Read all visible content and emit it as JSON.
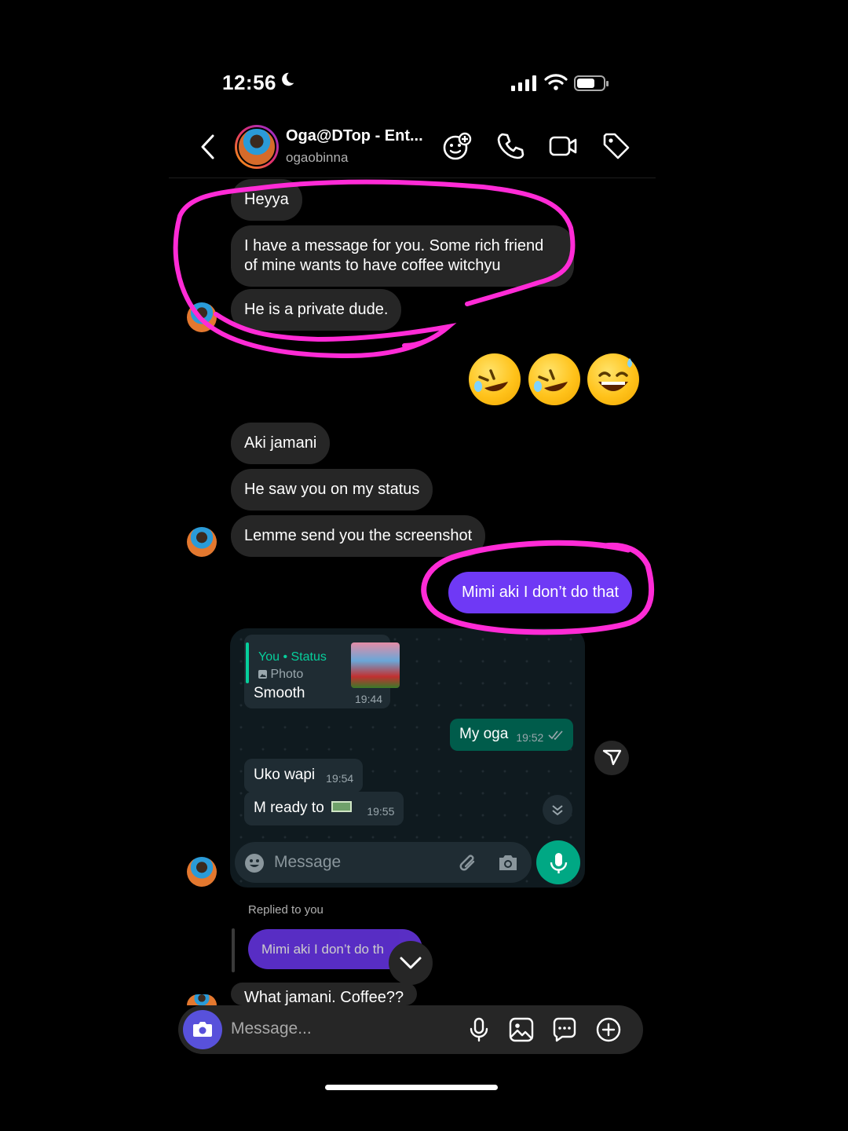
{
  "status_bar": {
    "time": "12:56"
  },
  "header": {
    "name": "Oga@DTop - Ent...",
    "handle": "ogaobinna"
  },
  "thread": {
    "group1": [
      "Heyya",
      "I have a message for you. Some rich friend of mine wants to have coffee witchyu",
      "He is a private dude."
    ],
    "group2": [
      "Aki jamani",
      "He saw you on my status",
      "Lemme send you the screenshot"
    ],
    "mine1": "Mimi aki I don’t do that",
    "replied_label": "Replied to you",
    "mine_reply_quote": "Mimi aki I don’t do th",
    "partial_incoming": "What jamani. Coffee??"
  },
  "screenshot": {
    "reply_title": "You • Status",
    "reply_sub": "Photo",
    "msg1": "Smooth",
    "msg1_time": "19:44",
    "msg2": "My oga",
    "msg2_time": "19:52",
    "msg3": "Uko wapi",
    "msg3_time": "19:54",
    "msg4": "M ready to",
    "msg4_time": "19:55",
    "input_placeholder": "Message"
  },
  "composer": {
    "placeholder": "Message..."
  },
  "colors": {
    "mine_bubble": "#6f39f5",
    "incoming_bubble": "#262626",
    "annotation": "#ff2bd6",
    "wa_green": "#00a884"
  },
  "icons": [
    "back-icon",
    "sticker-add-icon",
    "phone-icon",
    "video-icon",
    "tag-icon",
    "camera-icon",
    "mic-icon",
    "image-icon",
    "chat-icon",
    "plus-icon",
    "send-icon",
    "chevron-down-icon"
  ]
}
